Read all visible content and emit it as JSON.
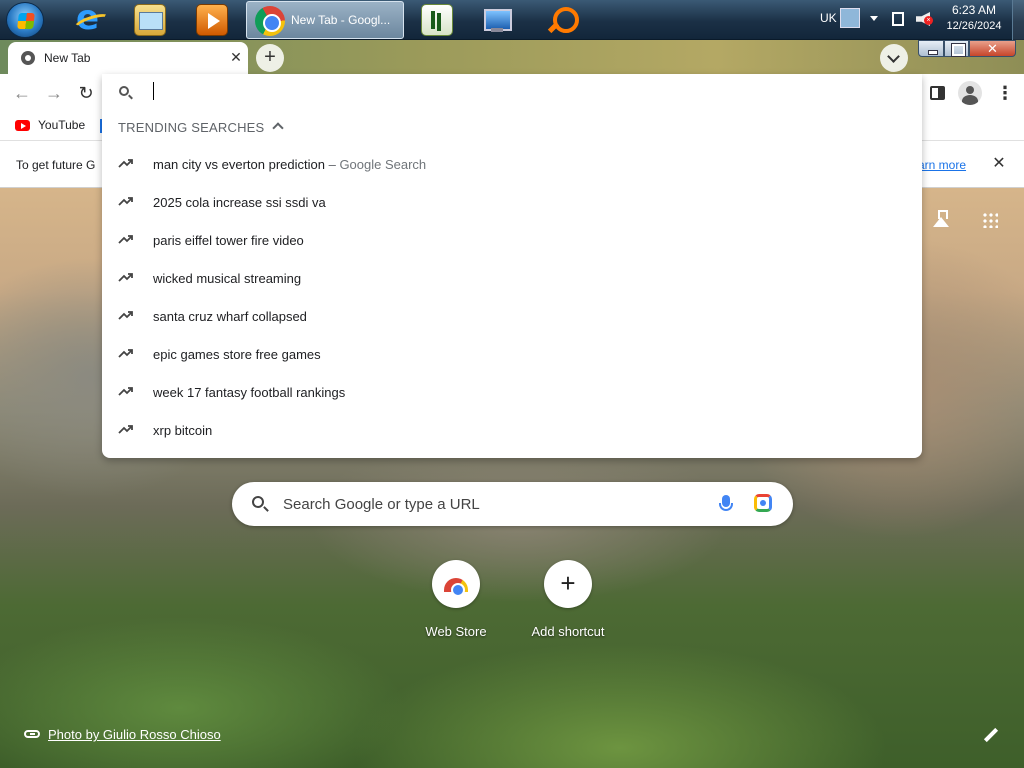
{
  "taskbar": {
    "chrome_button_label": "New Tab - Googl...",
    "tray": {
      "language": "UK",
      "time": "6:23 AM",
      "date": "12/26/2024"
    }
  },
  "browser": {
    "tab_title": "New Tab",
    "tab_close_glyph": "✕",
    "new_tab_glyph": "+",
    "window_close_glyph": "✕",
    "nav": {
      "back": "←",
      "forward": "→",
      "reload": "↻",
      "menu": "⋮"
    }
  },
  "bookmarks": [
    {
      "label": "YouTube",
      "icon": "youtube-icon"
    }
  ],
  "infobar": {
    "text": "To get future G",
    "link": "arn more",
    "close_glyph": "✕"
  },
  "omnibox": {
    "value": "",
    "header": "TRENDING SEARCHES",
    "suggestions": [
      {
        "text": "man city vs everton prediction",
        "separator": " – ",
        "source": "Google Search"
      },
      {
        "text": "2025 cola increase ssi ssdi va"
      },
      {
        "text": "paris eiffel tower fire video"
      },
      {
        "text": "wicked musical streaming"
      },
      {
        "text": "santa cruz wharf collapsed"
      },
      {
        "text": "epic games store free games"
      },
      {
        "text": "week 17 fantasy football rankings"
      },
      {
        "text": "xrp bitcoin"
      }
    ]
  },
  "ntp": {
    "search_placeholder": "Search Google or type a URL",
    "shortcuts": [
      {
        "label": "Web Store",
        "icon": "webstore-icon"
      },
      {
        "label": "Add shortcut",
        "icon": "plus-icon",
        "glyph": "+"
      }
    ],
    "photo_credit": "Photo by Giulio Rosso Chioso"
  },
  "colors": {
    "link": "#1a73e8",
    "omnibox_bg": "#ffffff",
    "taskbar": "#1b3046"
  }
}
